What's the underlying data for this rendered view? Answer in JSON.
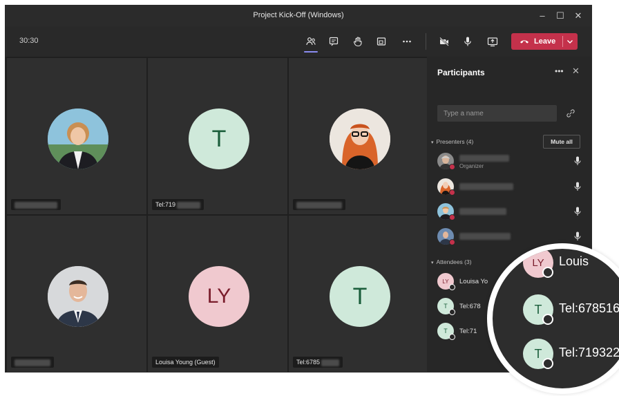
{
  "window": {
    "title": "Project Kick-Off (Windows)"
  },
  "toolbar": {
    "timer": "30:30",
    "leave_label": "Leave",
    "icons": [
      "people-icon",
      "chat-icon",
      "raise-hand-icon",
      "share-tray-icon",
      "more-icon",
      "camera-off-icon",
      "mic-icon",
      "share-screen-icon"
    ]
  },
  "tiles": [
    {
      "type": "photo",
      "photo": "woman-blonde",
      "caption": ""
    },
    {
      "type": "initials",
      "initials": "T",
      "caption": "Tel:719"
    },
    {
      "type": "photo",
      "photo": "woman-redhair",
      "caption": ""
    },
    {
      "type": "photo",
      "photo": "man-suit",
      "caption": ""
    },
    {
      "type": "initials",
      "initials": "LY",
      "caption": "Louisa Young (Guest)"
    },
    {
      "type": "initials",
      "initials": "T",
      "caption": "Tel:6785"
    }
  ],
  "participants": {
    "title": "Participants",
    "search_placeholder": "Type a name",
    "presenters_label": "Presenters (4)",
    "mute_all_label": "Mute all",
    "presenters": [
      {
        "photo": "woman-grey",
        "role": "Organizer"
      },
      {
        "photo": "woman-redhair"
      },
      {
        "photo": "woman-blonde"
      },
      {
        "photo": "man-suit"
      }
    ],
    "attendees_label": "Attendees (3)",
    "attendees": [
      {
        "initials": "LY",
        "name": "Louisa Yo"
      },
      {
        "initials": "T",
        "name": "Tel:678"
      },
      {
        "initials": "T",
        "name": "Tel:71"
      }
    ]
  },
  "magnifier": {
    "rows": [
      {
        "initials": "LY",
        "text": "Louis"
      },
      {
        "initials": "T",
        "text": "Tel:678516"
      },
      {
        "initials": "T",
        "text": "Tel:719322"
      }
    ]
  },
  "colors": {
    "leave": "#c4314b",
    "accent": "#8b8cf1",
    "initials_t_bg": "#cfe9da",
    "initials_t_fg": "#1b5e3b",
    "initials_ly_bg": "#f0c9cf",
    "initials_ly_fg": "#7a1d2c",
    "status_red": "#c4314b"
  }
}
